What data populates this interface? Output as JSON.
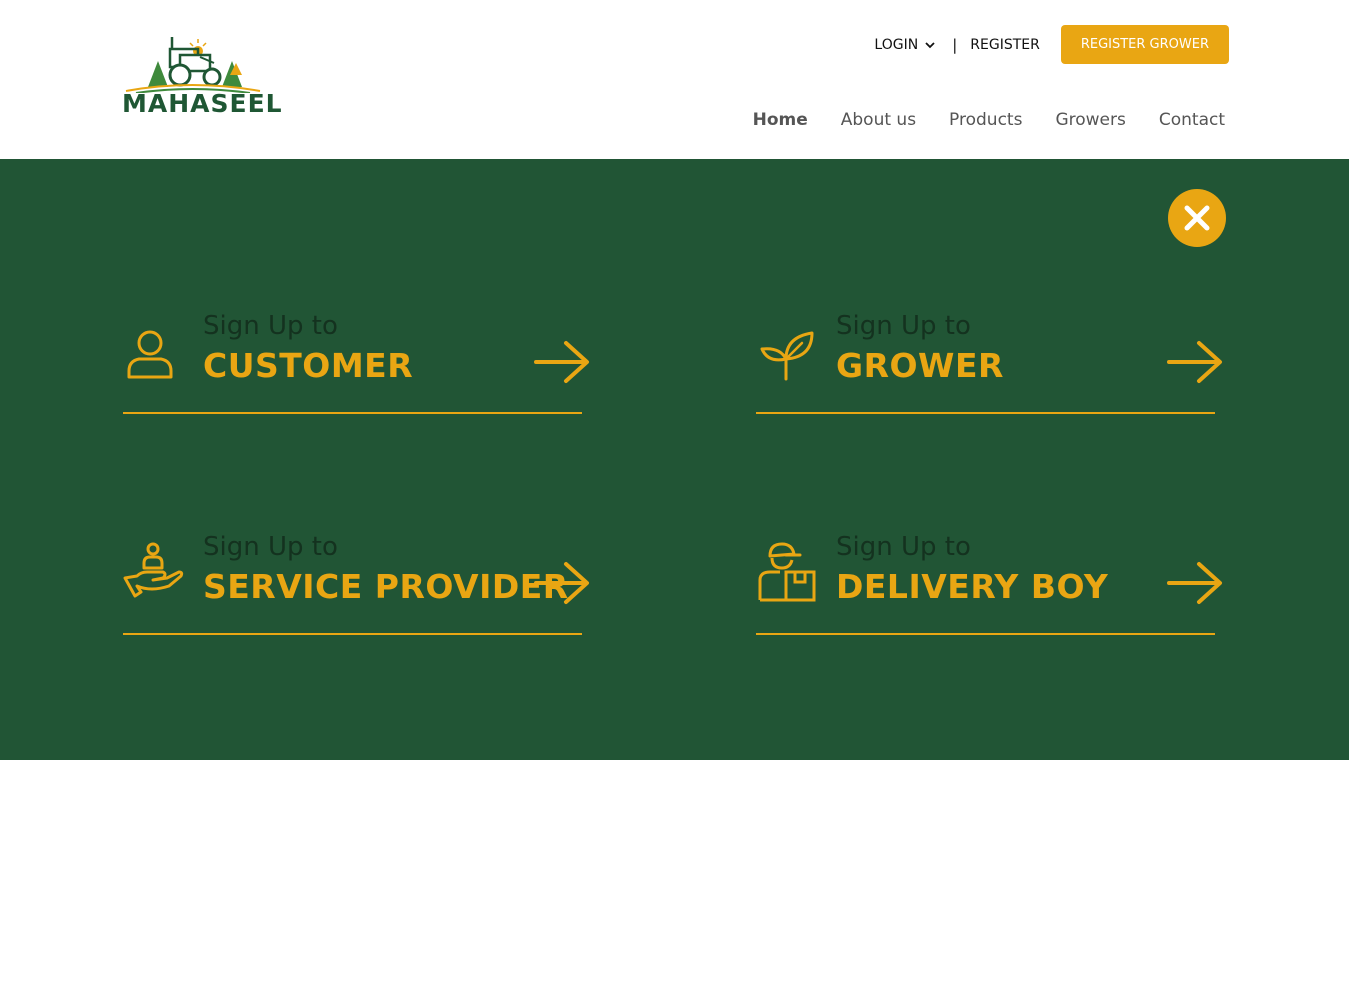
{
  "brand": {
    "name": "MAHASEEL",
    "primary": "#215535",
    "accent": "#e9a613"
  },
  "topbar": {
    "login_label": "LOGIN",
    "separator": "|",
    "register_label": "REGISTER",
    "register_grower_label": "REGISTER GROWER"
  },
  "nav": {
    "items": [
      "Home",
      "About us",
      "Products",
      "Growers",
      "Contact"
    ],
    "active": "Home"
  },
  "signup": {
    "prefix": "Sign Up to",
    "options": [
      {
        "label": "CUSTOMER",
        "icon": "user-icon"
      },
      {
        "label": "GROWER",
        "icon": "sprout-icon"
      },
      {
        "label": "SERVICE PROVIDER",
        "icon": "hand-person-icon"
      },
      {
        "label": "DELIVERY BOY",
        "icon": "delivery-person-icon"
      }
    ]
  }
}
